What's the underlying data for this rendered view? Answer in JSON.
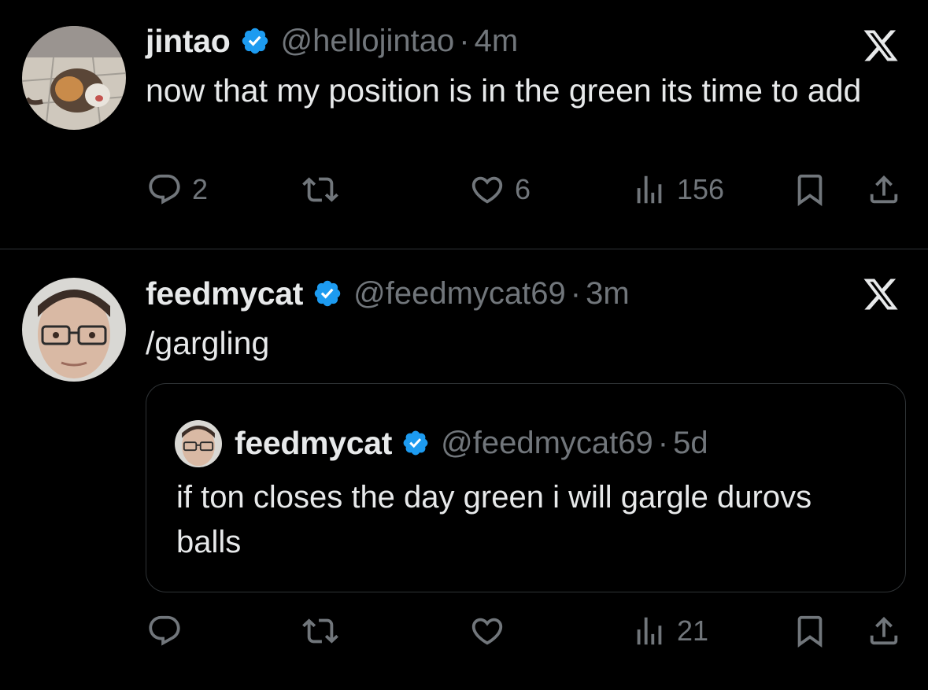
{
  "tweets": [
    {
      "name": "jintao",
      "handle": "@hellojintao",
      "separator": "·",
      "time": "4m",
      "text": "now that my position is in the green its time to add",
      "replies": "2",
      "retweets": "",
      "likes": "6",
      "views": "156",
      "avatar": "cat-photo"
    },
    {
      "name": "feedmycat",
      "handle": "@feedmycat69",
      "separator": "·",
      "time": "3m",
      "text": "/gargling",
      "replies": "",
      "retweets": "",
      "likes": "",
      "views": "21",
      "avatar": "man-with-glasses-photo",
      "quote": {
        "name": "feedmycat",
        "handle": "@feedmycat69",
        "separator": "·",
        "time": "5d",
        "text": "if ton closes the day green i will gargle durovs balls"
      }
    }
  ],
  "colors": {
    "background": "#000000",
    "text": "#e7e9ea",
    "muted": "#71767b",
    "verified": "#1d9bf0",
    "divider": "#2f3336"
  },
  "icons": [
    "verified-badge-icon",
    "x-logo-icon",
    "reply-icon",
    "retweet-icon",
    "like-icon",
    "views-icon",
    "bookmark-icon",
    "share-icon"
  ]
}
